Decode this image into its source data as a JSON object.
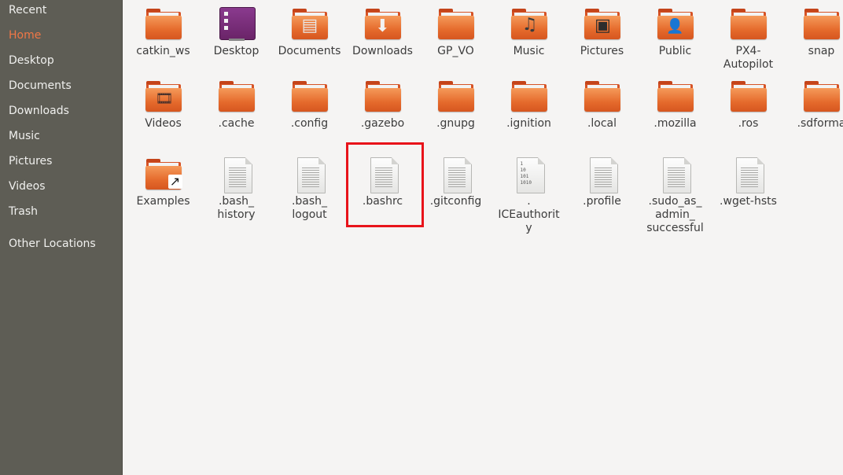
{
  "sidebar": {
    "items": [
      {
        "label": "Recent",
        "name": "sidebar-item-recent",
        "active": false
      },
      {
        "label": "Home",
        "name": "sidebar-item-home",
        "active": true
      },
      {
        "label": "Desktop",
        "name": "sidebar-item-desktop",
        "active": false
      },
      {
        "label": "Documents",
        "name": "sidebar-item-documents",
        "active": false
      },
      {
        "label": "Downloads",
        "name": "sidebar-item-downloads",
        "active": false
      },
      {
        "label": "Music",
        "name": "sidebar-item-music",
        "active": false
      },
      {
        "label": "Pictures",
        "name": "sidebar-item-pictures",
        "active": false
      },
      {
        "label": "Videos",
        "name": "sidebar-item-videos",
        "active": false
      },
      {
        "label": "Trash",
        "name": "sidebar-item-trash",
        "active": false
      },
      {
        "label": "Other Locations",
        "name": "sidebar-item-other-locations",
        "active": false
      }
    ]
  },
  "files": [
    {
      "label": "catkin_ws",
      "kind": "folder"
    },
    {
      "label": "Desktop",
      "kind": "desktop"
    },
    {
      "label": "Documents",
      "kind": "folder-documents"
    },
    {
      "label": "Downloads",
      "kind": "folder-downloads"
    },
    {
      "label": "GP_VO",
      "kind": "folder"
    },
    {
      "label": "Music",
      "kind": "folder-music"
    },
    {
      "label": "Pictures",
      "kind": "folder-pictures"
    },
    {
      "label": "Public",
      "kind": "folder-public"
    },
    {
      "label": "PX4-\nAutopilot",
      "kind": "folder"
    },
    {
      "label": "snap",
      "kind": "folder"
    },
    {
      "label": "Videos",
      "kind": "folder-videos"
    },
    {
      "label": ".cache",
      "kind": "folder"
    },
    {
      "label": ".config",
      "kind": "folder"
    },
    {
      "label": ".gazebo",
      "kind": "folder"
    },
    {
      "label": ".gnupg",
      "kind": "folder"
    },
    {
      "label": ".ignition",
      "kind": "folder"
    },
    {
      "label": ".local",
      "kind": "folder"
    },
    {
      "label": ".mozilla",
      "kind": "folder"
    },
    {
      "label": ".ros",
      "kind": "folder"
    },
    {
      "label": ".sdforma",
      "kind": "folder"
    },
    {
      "label": "Examples",
      "kind": "folder-link"
    },
    {
      "label": ".bash_\nhistory",
      "kind": "text"
    },
    {
      "label": ".bash_\nlogout",
      "kind": "text"
    },
    {
      "label": ".bashrc",
      "kind": "text",
      "highlighted": true
    },
    {
      "label": ".gitconfig",
      "kind": "text"
    },
    {
      "label": ".\nICEauthorit\ny",
      "kind": "binary"
    },
    {
      "label": ".profile",
      "kind": "text"
    },
    {
      "label": ".sudo_as_\nadmin_\nsuccessful",
      "kind": "text"
    },
    {
      "label": ".wget-hsts",
      "kind": "text"
    }
  ],
  "binary_icon_text": "1\n10\n101\n1010",
  "colors": {
    "sidebar_bg": "#5e5d55",
    "active_accent": "#f07746",
    "folder_orange": "#e56a2c",
    "highlight_red": "#e8131a"
  }
}
